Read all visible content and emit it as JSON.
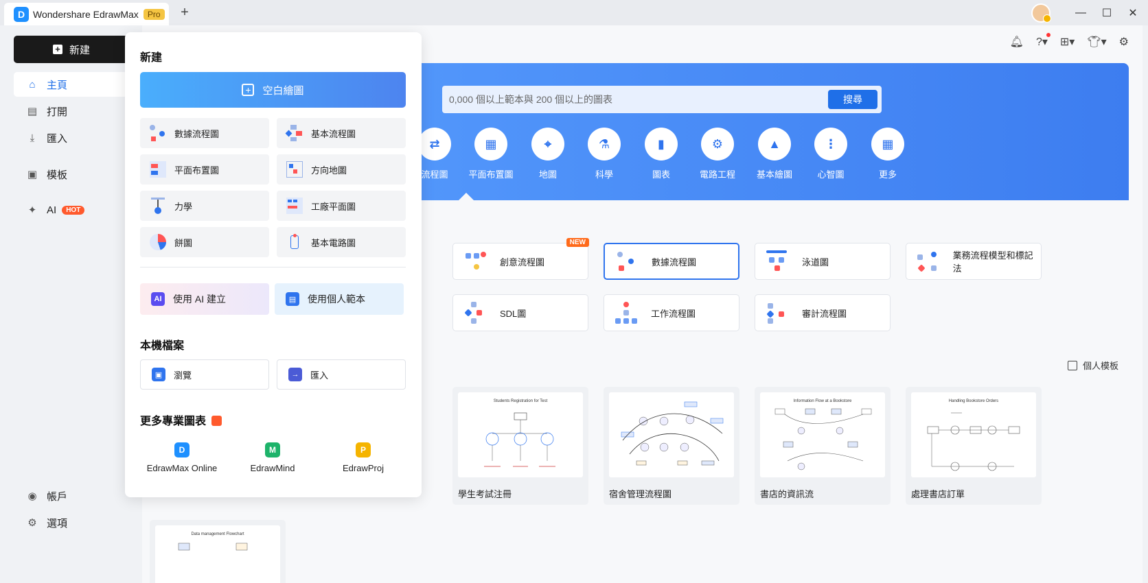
{
  "titlebar": {
    "app_name": "Wondershare EdrawMax",
    "badge": "Pro",
    "logo_letter": "D",
    "new_tab": "+",
    "win_min": "—",
    "win_max": "☐",
    "win_close": "✕"
  },
  "sidebar": {
    "new_button": "新建",
    "items": [
      {
        "label": "主頁",
        "icon": "home-icon"
      },
      {
        "label": "打開",
        "icon": "file-icon"
      },
      {
        "label": "匯入",
        "icon": "import-icon"
      },
      {
        "label": "模板",
        "icon": "template-icon"
      },
      {
        "label": "AI",
        "icon": "ai-sparkle-icon",
        "badge": "HOT"
      }
    ],
    "account": "帳戶",
    "options": "選項"
  },
  "main": {
    "search_placeholder": "0,000 個以上範本與 200 個以上的圖表",
    "search_button": "搜尋",
    "categories": [
      "流程圖",
      "平面布置圖",
      "地圖",
      "科學",
      "圖表",
      "電路工程",
      "基本繪圖",
      "心智圖",
      "更多"
    ],
    "templates": [
      {
        "label": "創意流程圖",
        "new": "NEW"
      },
      {
        "label": "數據流程圖"
      },
      {
        "label": "泳道圖"
      },
      {
        "label": "業務流程模型和標記法"
      },
      {
        "label": "SDL圖"
      },
      {
        "label": "工作流程圖"
      },
      {
        "label": "審計流程圖"
      }
    ],
    "personal_templates": "個人模板",
    "thumbnails": [
      {
        "title": "學生考試注冊",
        "inner": "Students Registration for Test"
      },
      {
        "title": "宿舍管理流程圖",
        "inner": ""
      },
      {
        "title": "書店的資訊流",
        "inner": "Information Flow at a Bookstore"
      },
      {
        "title": "處理書店訂單",
        "inner": "Handling Bookstore Orders"
      }
    ],
    "bottom_thumb_inner": "Data management Flowchart"
  },
  "popup": {
    "title": "新建",
    "blank": "空白繪圖",
    "items": [
      "數據流程圖",
      "基本流程圖",
      "平面布置圖",
      "方向地圖",
      "力學",
      "工廠平面圖",
      "餅圖",
      "基本電路圖"
    ],
    "ai_create": "使用 AI 建立",
    "my_template": "使用個人範本",
    "local_files": "本機檔案",
    "browse": "瀏覽",
    "import": "匯入",
    "more_title": "更多專業圖表",
    "products": [
      "EdrawMax Online",
      "EdrawMind",
      "EdrawProj"
    ]
  },
  "colors": {
    "accent": "#2f74ee",
    "banner_start": "#5aa0ff",
    "banner_end": "#3d7df0",
    "hot_badge": "#ff5a2d",
    "new_badge": "#ff6a1a"
  }
}
